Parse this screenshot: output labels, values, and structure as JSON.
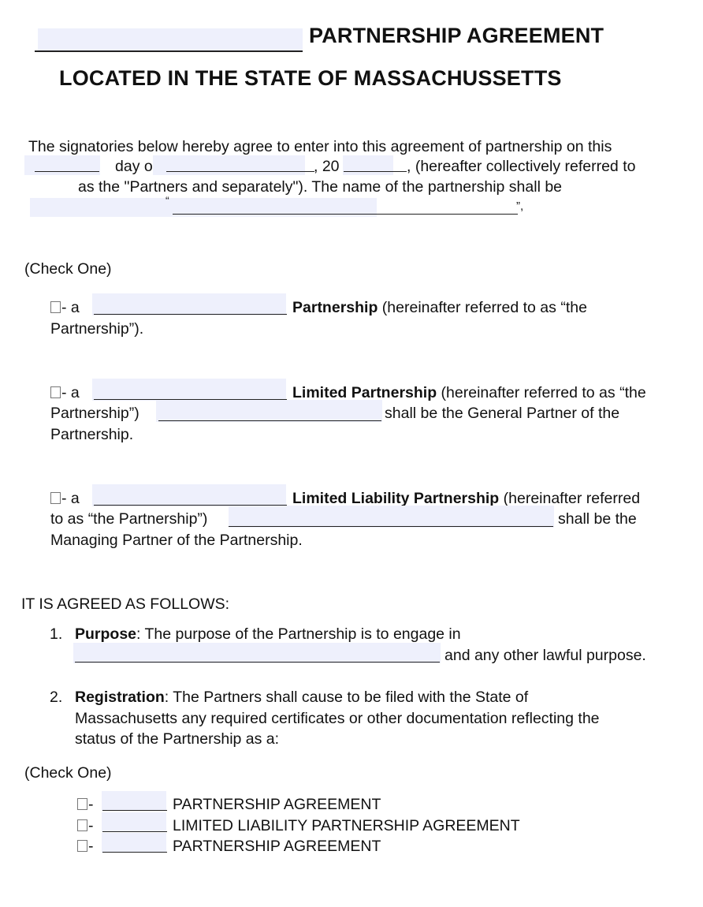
{
  "header": {
    "title_suffix": "PARTNERSHIP AGREEMENT",
    "subtitle": "LOCATED IN THE STATE OF MASSACHUSSETTS"
  },
  "intro": {
    "line1": "The signatories below hereby agree to enter into this agreement of partnership on this",
    "line2_day": "day of",
    "line2_year_prefix": ", 20",
    "line2_suffix": ", (hereafter collectively referred to",
    "line3": "as the \"Partners and separately\").   The name of the partnership shall be",
    "open_quote": "“",
    "close_quote": "”,",
    "fields": {
      "day": "",
      "month": "",
      "year": "",
      "partnership_name": ""
    }
  },
  "check_one_label": "(Check One)",
  "partnership_options": [
    {
      "prefix": "- a",
      "bold": "Partnership",
      "after_bold": "(hereinafter referred to as “the",
      "line2": "Partnership”).",
      "checked": false,
      "name_value": ""
    },
    {
      "prefix": "- a",
      "bold": "Limited Partnership",
      "after_bold": "(hereinafter referred to as “the",
      "line2_prefix": "Partnership”)",
      "line2_suffix": "shall be the General Partner of the",
      "line3": "Partnership.",
      "checked": false,
      "name_value": "",
      "partner_value": ""
    },
    {
      "prefix": "- a",
      "bold": "Limited Liability Partnership",
      "after_bold": "(hereinafter referred",
      "line2_prefix": "to as “the Partnership”)",
      "line2_suffix": "shall be the",
      "line3": "Managing Partner of the Partnership.",
      "checked": false,
      "name_value": "",
      "partner_value": ""
    }
  ],
  "agreed_heading": "IT IS AGREED AS FOLLOWS:",
  "sections": [
    {
      "number": "1.",
      "heading": "Purpose",
      "text": ": The purpose of the Partnership is to engage in",
      "line2_suffix": "and any other lawful purpose.",
      "field_value": ""
    },
    {
      "number": "2.",
      "heading": "Registration",
      "text": ": The Partners shall cause to be filed with the State of",
      "line2": "Massachusetts any required certificates or other documentation reflecting the",
      "line3": "status of the Partnership as a:"
    }
  ],
  "check_one_label_2": "(Check One)",
  "registration_options": [
    {
      "dash": "-",
      "label": "PARTNERSHIP AGREEMENT",
      "checked": false,
      "value": ""
    },
    {
      "dash": "-",
      "label": "LIMITED LIABILITY PARTNERSHIP AGREEMENT",
      "checked": false,
      "value": ""
    },
    {
      "dash": "-",
      "label": "PARTNERSHIP AGREEMENT",
      "checked": false,
      "value": ""
    }
  ]
}
